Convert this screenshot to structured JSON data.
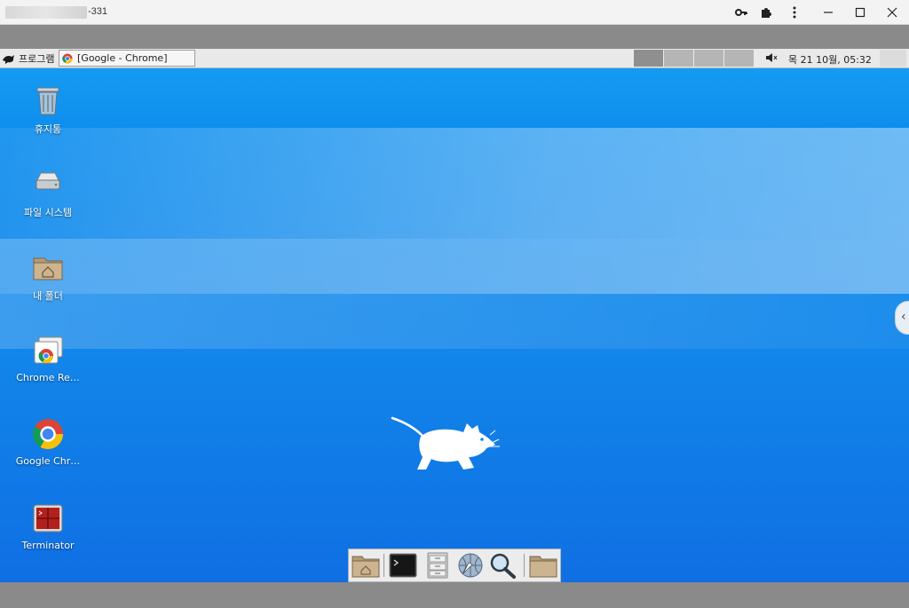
{
  "window": {
    "title_suffix": "-331",
    "controls": [
      "key-icon",
      "extensions-icon",
      "more-icon",
      "minimize-icon",
      "maximize-icon",
      "close-icon"
    ]
  },
  "panel": {
    "menu_label": "프로그램",
    "task_button_label": "[Google - Chrome]",
    "clock": "목 21 10월, 05:32"
  },
  "desktop": {
    "icons": [
      {
        "label": "휴지통",
        "icon": "trash-icon"
      },
      {
        "label": "파일 시스템",
        "icon": "drive-icon"
      },
      {
        "label": "내 폴더",
        "icon": "home-folder-icon"
      },
      {
        "label": "Chrome Re…",
        "icon": "chrome-remote-icon"
      },
      {
        "label": "Google Chr…",
        "icon": "chrome-icon"
      },
      {
        "label": "Terminator",
        "icon": "terminator-icon"
      }
    ]
  },
  "dock": {
    "items": [
      "home-folder-icon",
      "terminal-icon",
      "file-manager-icon",
      "web-browser-icon",
      "search-icon",
      "folder-icon"
    ]
  },
  "colors": {
    "desktop_blue": "#1286ea",
    "panel_bg": "#e9e9e9",
    "titlebar_bg": "#f3f3f3"
  }
}
